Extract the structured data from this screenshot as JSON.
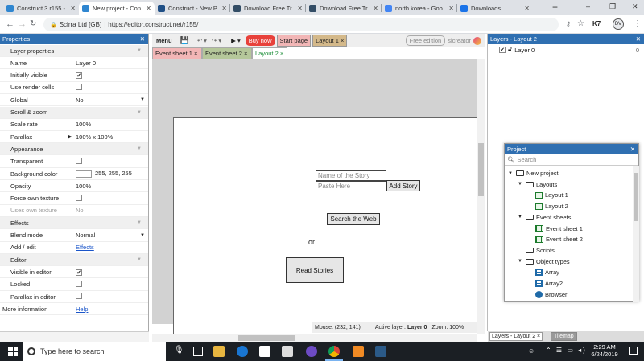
{
  "browser": {
    "tabs": [
      {
        "title": "Construct 3 r155 -",
        "color": "#2f86d0"
      },
      {
        "title": "New project - Con",
        "color": "#2f86d0"
      },
      {
        "title": "Construct - New P",
        "color": "#1f4f86"
      },
      {
        "title": "Download Free Tr",
        "color": "#334d66"
      },
      {
        "title": "Download Free Tr",
        "color": "#334d66"
      },
      {
        "title": "north korea - Goo",
        "color": "#4285f4"
      },
      {
        "title": "Downloads",
        "color": "#1a73e8"
      }
    ],
    "active_tab": 1,
    "new_tab": "+",
    "site_name": "Scirra Ltd [GB]",
    "url": "https://editor.construct.net/r155/",
    "profile": "DV",
    "window_controls": [
      "–",
      "❐",
      "✕"
    ]
  },
  "properties": {
    "title": "Properties",
    "rows": [
      {
        "type": "cat",
        "label": "Layer properties"
      },
      {
        "label": "Name",
        "value": "Layer 0"
      },
      {
        "label": "Initially visible",
        "check": true
      },
      {
        "label": "Use render cells",
        "check": false
      },
      {
        "label": "Global",
        "value": "No",
        "dropdown": true
      },
      {
        "type": "cat",
        "label": "Scroll & zoom"
      },
      {
        "label": "Scale rate",
        "value": "100%"
      },
      {
        "label": "Parallax",
        "value": "100% x 100%",
        "expander": true
      },
      {
        "type": "cat",
        "label": "Appearance"
      },
      {
        "label": "Transparent",
        "check": false
      },
      {
        "label": "Background color",
        "value": "255, 255, 255",
        "swatch": "#ffffff"
      },
      {
        "label": "Opacity",
        "value": "100%"
      },
      {
        "label": "Force own texture",
        "check": false
      },
      {
        "label": "Uses own texture",
        "value": "No",
        "disabled": true
      },
      {
        "type": "cat",
        "label": "Effects"
      },
      {
        "label": "Blend mode",
        "value": "Normal",
        "dropdown": true
      },
      {
        "label": "Add / edit",
        "link": "Effects"
      },
      {
        "type": "cat",
        "label": "Editor"
      },
      {
        "label": "Visible in editor",
        "check": true
      },
      {
        "label": "Locked",
        "check": false
      },
      {
        "label": "Parallax in editor",
        "check": false
      },
      {
        "type": "info",
        "label": "More information",
        "link": "Help"
      }
    ]
  },
  "toolbar": {
    "menu": "Menu",
    "buy_now": "Buy now",
    "start_page": "Start page",
    "layout1_tab": "Layout 1",
    "edition": "Free edition",
    "user": "sicreator"
  },
  "editor_tabs": [
    "Event sheet 1",
    "Event sheet 2",
    "Layout 2"
  ],
  "layout": {
    "name_placeholder": "Name of the Story",
    "paste_placeholder": "Paste Here",
    "add_story": "Add Story",
    "search_web": "Search the Web",
    "or_text": "or",
    "read_stories": "Read Stories"
  },
  "status": {
    "mouse": "Mouse: (232, 141)",
    "active_layer_label": "Active layer:",
    "active_layer": "Layer 0",
    "zoom": "Zoom: 100%"
  },
  "layers": {
    "title": "Layers - Layout 2",
    "items": [
      {
        "name": "Layer 0",
        "count": "0"
      }
    ],
    "bottom_tabs": [
      "Layers - Layout 2",
      "Tilemap"
    ]
  },
  "project": {
    "title": "Project",
    "search_placeholder": "Search",
    "tree": [
      {
        "label": "New project",
        "icon": "folder",
        "level": 0,
        "expanded": true
      },
      {
        "label": "Layouts",
        "icon": "folder",
        "level": 1,
        "expanded": true
      },
      {
        "label": "Layout 1",
        "icon": "layout",
        "level": 2
      },
      {
        "label": "Layout 2",
        "icon": "layout",
        "level": 2
      },
      {
        "label": "Event sheets",
        "icon": "folder",
        "level": 1,
        "expanded": true
      },
      {
        "label": "Event sheet 1",
        "icon": "eventsheet",
        "level": 2
      },
      {
        "label": "Event sheet 2",
        "icon": "eventsheet",
        "level": 2
      },
      {
        "label": "Scripts",
        "icon": "folder",
        "level": 1
      },
      {
        "label": "Object types",
        "icon": "folder",
        "level": 1,
        "expanded": true
      },
      {
        "label": "Array",
        "icon": "grid",
        "level": 2
      },
      {
        "label": "Array2",
        "icon": "grid",
        "level": 2
      },
      {
        "label": "Browser",
        "icon": "globe",
        "level": 2
      }
    ]
  },
  "taskbar": {
    "search_placeholder": "Type here to search",
    "time": "2:29 AM",
    "date": "6/24/2019"
  }
}
